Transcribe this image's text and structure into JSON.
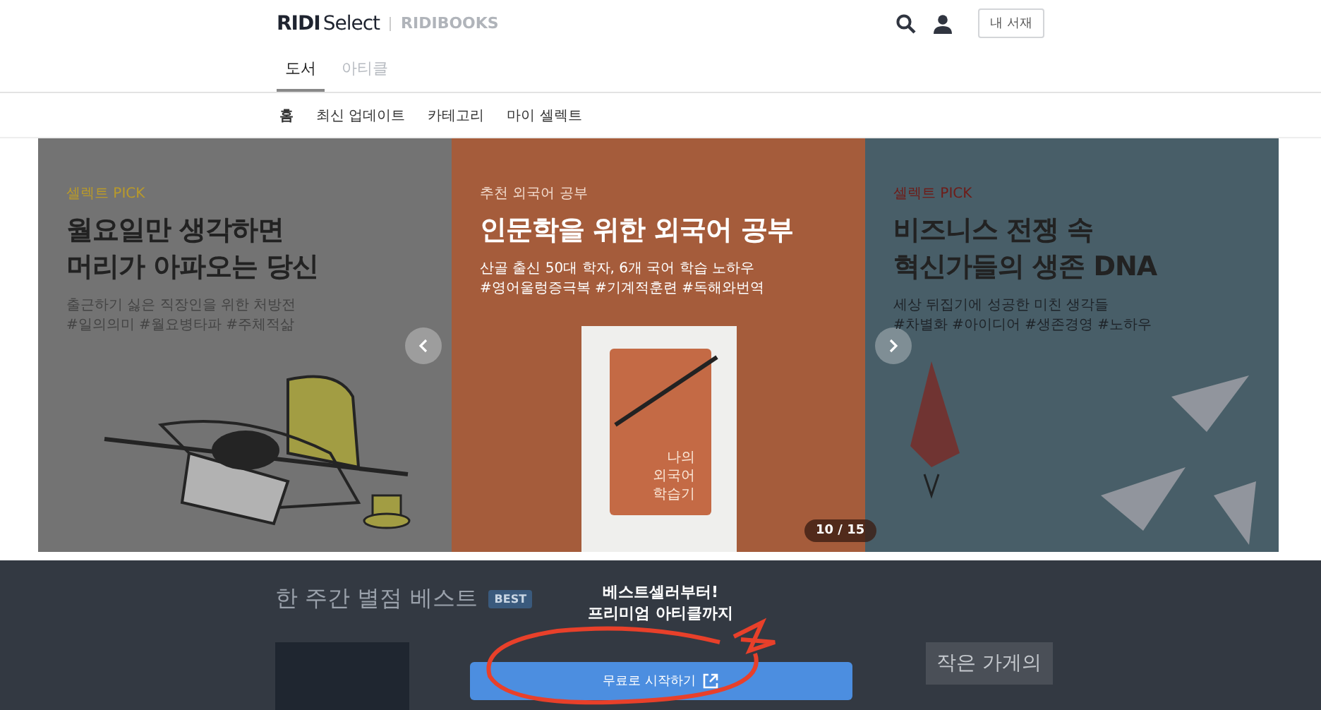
{
  "header": {
    "logo_main": "RIDI",
    "logo_sub": "Select",
    "logo_partner": "RIDIBOOKS",
    "library_button": "내 서재"
  },
  "tabs": [
    {
      "label": "도서",
      "selected": true
    },
    {
      "label": "아티클",
      "selected": false
    }
  ],
  "subnav": [
    {
      "label": "홈",
      "selected": true
    },
    {
      "label": "최신 업데이트",
      "selected": false
    },
    {
      "label": "카테고리",
      "selected": false
    },
    {
      "label": "마이 셀렉트",
      "selected": false
    }
  ],
  "slides": [
    {
      "kind": "worker",
      "selected": false,
      "eyebrow": "셀렉트 PICK",
      "title": [
        "월요일만 생각하면",
        "머리가 아파오는 당신"
      ],
      "desc": [
        "출근하기 싫은 직장인을 위한 처방전",
        "#일의의미 #월요병타파 #주체적삶"
      ]
    },
    {
      "kind": "book",
      "selected": true,
      "eyebrow": "추천 외국어 공부",
      "title": [
        "인문학을 위한 외국어 공부"
      ],
      "desc": [
        "산골 출신 50대 학자, 6개 국어 학습 노하우",
        "#영어울렁증극복 #기계적훈련 #독해와번역"
      ],
      "cover_title": "나의 외국어 학습기"
    },
    {
      "kind": "planes",
      "selected": false,
      "eyebrow": "셀렉트 PICK",
      "title": [
        "비즈니스 전쟁 속",
        "혁신가들의 생존 DNA"
      ],
      "desc": [
        "세상 뒤집기에 성공한 미친 생각들",
        "#차별화 #아이디어 #생존경영 #노하우"
      ]
    }
  ],
  "slide_counter": "10 / 15",
  "section": {
    "title": "한 주간 별점 베스트",
    "badge": "BEST",
    "book_text": "작은 가게의"
  },
  "promo": {
    "line1": "베스트셀러부터!",
    "line2": "프리미엄 아티클까지",
    "button": "무료로 시작하기"
  }
}
